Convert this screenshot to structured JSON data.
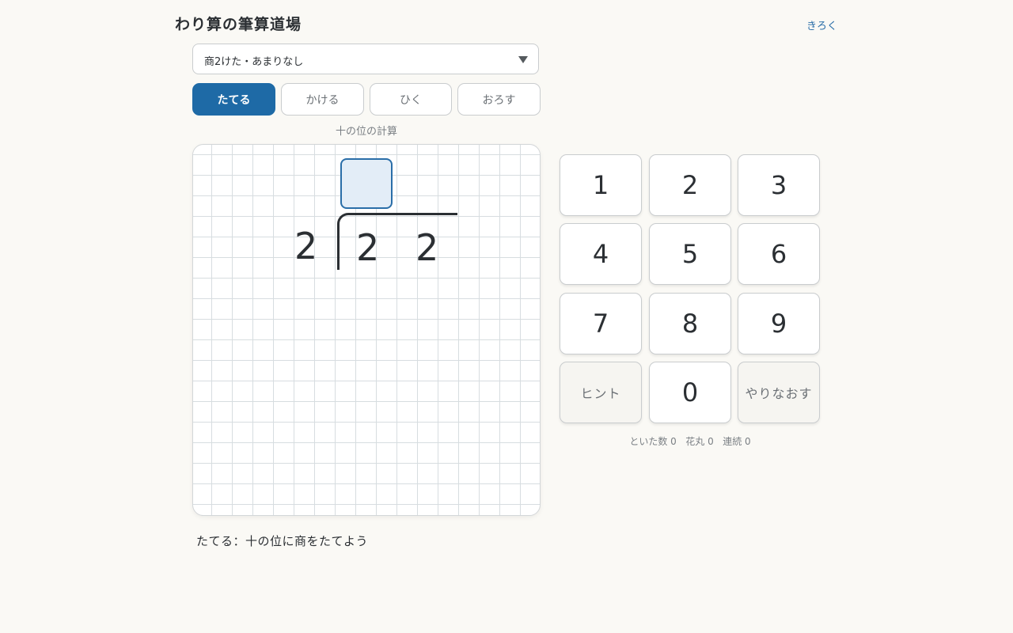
{
  "header": {
    "title": "わり算の筆算道場",
    "history_link": "きろく"
  },
  "level_select": {
    "selected": "商2けた・あまりなし"
  },
  "steps": [
    {
      "label": "たてる",
      "active": true
    },
    {
      "label": "かける",
      "active": false
    },
    {
      "label": "ひく",
      "active": false
    },
    {
      "label": "おろす",
      "active": false
    }
  ],
  "step_caption": "十の位の計算",
  "problem": {
    "divisor": "2",
    "dividend_digits": [
      "2",
      "2"
    ],
    "answer_input": ""
  },
  "keypad": {
    "keys": [
      "1",
      "2",
      "3",
      "4",
      "5",
      "6",
      "7",
      "8",
      "9"
    ],
    "hint_label": "ヒント",
    "zero_label": "0",
    "redo_label": "やりなおす"
  },
  "stats": {
    "solved_label": "といた数",
    "solved_value": "0",
    "flowers_label": "花丸",
    "flowers_value": "0",
    "streak_label": "連続",
    "streak_value": "0"
  },
  "instruction": "たてる：十の位に商をたてよう",
  "colors": {
    "accent": "#1e6aa6",
    "background": "#faf9f5",
    "answer_box_fill": "#e3edf7"
  }
}
